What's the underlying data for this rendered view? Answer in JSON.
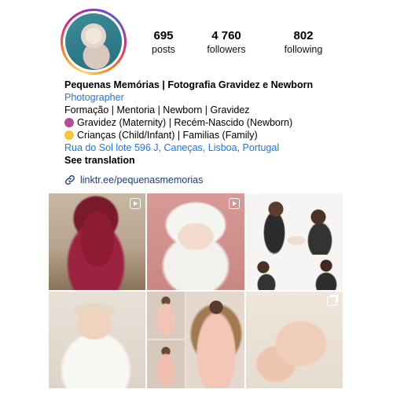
{
  "profile": {
    "name": "Pequenas Memórias | Fotografia Gravidez e Newborn",
    "category": "Photographer",
    "bio_lines": [
      "Formação | Mentoria | Newborn | Gravidez",
      "Gravidez (Maternity) | Recém-Nascido (Newborn)",
      "Crianças (Child/Infant) | Familias (Family)"
    ],
    "address": "Rua do Sol lote 596 J, Caneças, Lisboa, Portugal",
    "see_translation": "See translation",
    "link": "linktr.ee/pequenasmemorias"
  },
  "stats": [
    {
      "value": "695",
      "label": "posts"
    },
    {
      "value": "4 760",
      "label": "followers"
    },
    {
      "value": "802",
      "label": "following"
    }
  ],
  "posts": [
    {
      "id": "maternity-red-dress",
      "badge": "reel"
    },
    {
      "id": "newborn-white-bonnet",
      "badge": "reel"
    },
    {
      "id": "family-collage",
      "badge": "none"
    },
    {
      "id": "baby-white-wrap",
      "badge": "none"
    },
    {
      "id": "maternity-collage",
      "badge": "none"
    },
    {
      "id": "sleeping-newborn",
      "badge": "carousel"
    }
  ],
  "colors": {
    "link_blue": "#1877f2",
    "text": "#000000"
  }
}
